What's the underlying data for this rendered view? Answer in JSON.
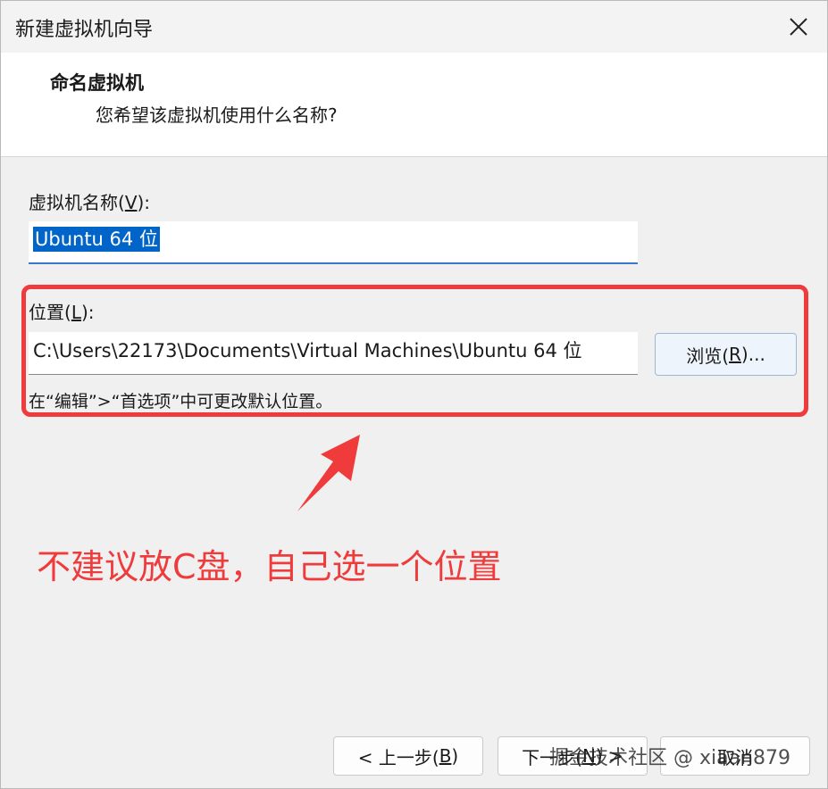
{
  "window": {
    "title": "新建虚拟机向导"
  },
  "header": {
    "title": "命名虚拟机",
    "subtitle": "您希望该虚拟机使用什么名称?"
  },
  "name_field": {
    "label_pre": "虚拟机名称(",
    "label_key": "V",
    "label_post": "):",
    "value": "Ubuntu 64 位"
  },
  "location_field": {
    "label_pre": "位置(",
    "label_key": "L",
    "label_post": "):",
    "value": "C:\\Users\\22173\\Documents\\Virtual Machines\\Ubuntu 64 位",
    "hint": "在“编辑”>“首选项”中可更改默认位置。"
  },
  "browse_button": {
    "label_pre": "浏览(",
    "label_key": "R",
    "label_post": ")..."
  },
  "annotation": {
    "text": "不建议放C盘，自己选一个位置",
    "color": "#ef3b3b"
  },
  "footer": {
    "back_pre": "< 上一步(",
    "back_key": "B",
    "back_post": ")",
    "next_pre": "下一步(",
    "next_key": "N",
    "next_post": ") >",
    "cancel_label": "取消"
  },
  "watermark": "掘金技术社区 @ xiaan879",
  "icons": {
    "close": "close-icon",
    "arrow": "arrow-up-annotation-icon"
  }
}
